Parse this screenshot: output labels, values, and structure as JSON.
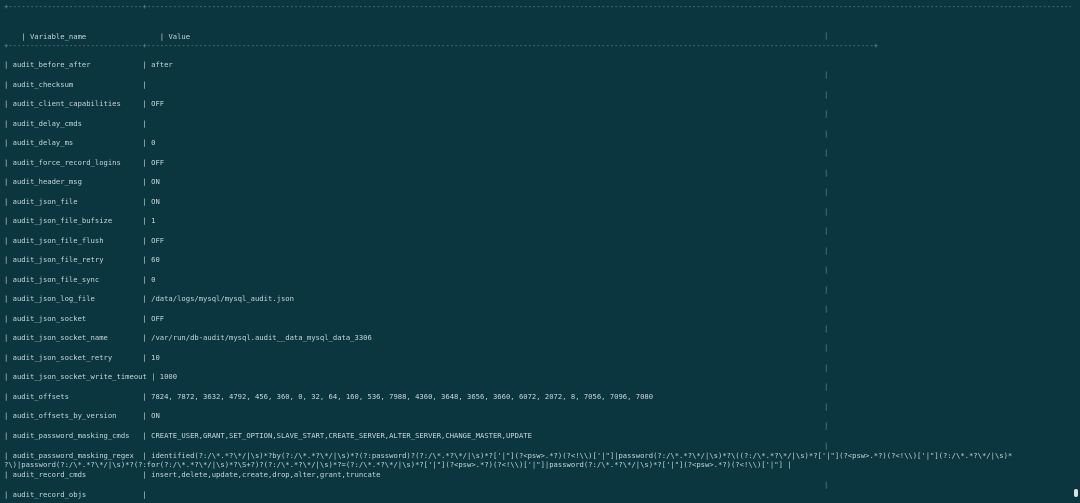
{
  "table": {
    "border_top": "+-------------------------------+------------------------------------------------------------------------------------------------------------------------------------------------------------------------+",
    "border_wide": "+-------------------------------+------------------------------------------------------------------------------------------------------------------------------------------------------------------------------------------------------------------------------------------------------------------------------------------------------------------------------------------------------------------------------------------------------+",
    "header": "| Variable_name                 | Value",
    "pipe": "|",
    "rows": [
      "| audit_before_after            | after",
      "| audit_checksum                |",
      "| audit_client_capabilities     | OFF",
      "| audit_delay_cmds              |",
      "| audit_delay_ms                | 0",
      "| audit_force_record_logins     | OFF",
      "| audit_header_msg              | ON",
      "| audit_json_file               | ON",
      "| audit_json_file_bufsize       | 1",
      "| audit_json_file_flush         | OFF",
      "| audit_json_file_retry         | 60",
      "| audit_json_file_sync          | 0",
      "| audit_json_log_file           | /data/logs/mysql/mysql_audit.json",
      "| audit_json_socket             | OFF",
      "| audit_json_socket_name        | /var/run/db-audit/mysql.audit__data_mysql_data_3306",
      "| audit_json_socket_retry       | 10",
      "| audit_json_socket_write_timeout | 1000",
      "| audit_offsets                 | 7824, 7872, 3632, 4792, 456, 360, 0, 32, 64, 160, 536, 7988, 4360, 3648, 3656, 3660, 6072, 2072, 8, 7056, 7096, 7080",
      "| audit_offsets_by_version      | ON",
      "| audit_password_masking_cmds   | CREATE_USER,GRANT,SET_OPTION,SLAVE_START,CREATE_SERVER,ALTER_SERVER,CHANGE_MASTER,UPDATE",
      "| audit_password_masking_regex  | identified(?:/\\*.*?\\*/|\\s)*?by(?:/\\*.*?\\*/|\\s)*?(?:password)?(?:/\\*.*?\\*/|\\s)*?['|\"](?<psw>.*?)(?<!\\\\)['|\"]|password(?:/\\*.*?\\*/|\\s)*?\\((?:/\\*.*?\\*/|\\s)*?['|\"](?<psw>.*?)(?<!\\\\)['|\"](?:/\\*.*?\\*/|\\s)*",
      "?\\)|password(?:/\\*.*?\\*/|\\s)*?(?:for(?:/\\*.*?\\*/|\\s)*?\\S+?)?(?:/\\*.*?\\*/|\\s)*?=(?:/\\*.*?\\*/|\\s)*?['|\"](?<psw>.*?)(?<!\\\\)['|\"]|password(?:/\\*.*?\\*/|\\s)*?['|\"](?<psw>.*?)(?<!\\\\)['|\"] |",
      "| audit_record_cmds             | insert,delete,update,create,drop,alter,grant,truncate",
      "| audit_record_objs             |"
    ]
  }
}
